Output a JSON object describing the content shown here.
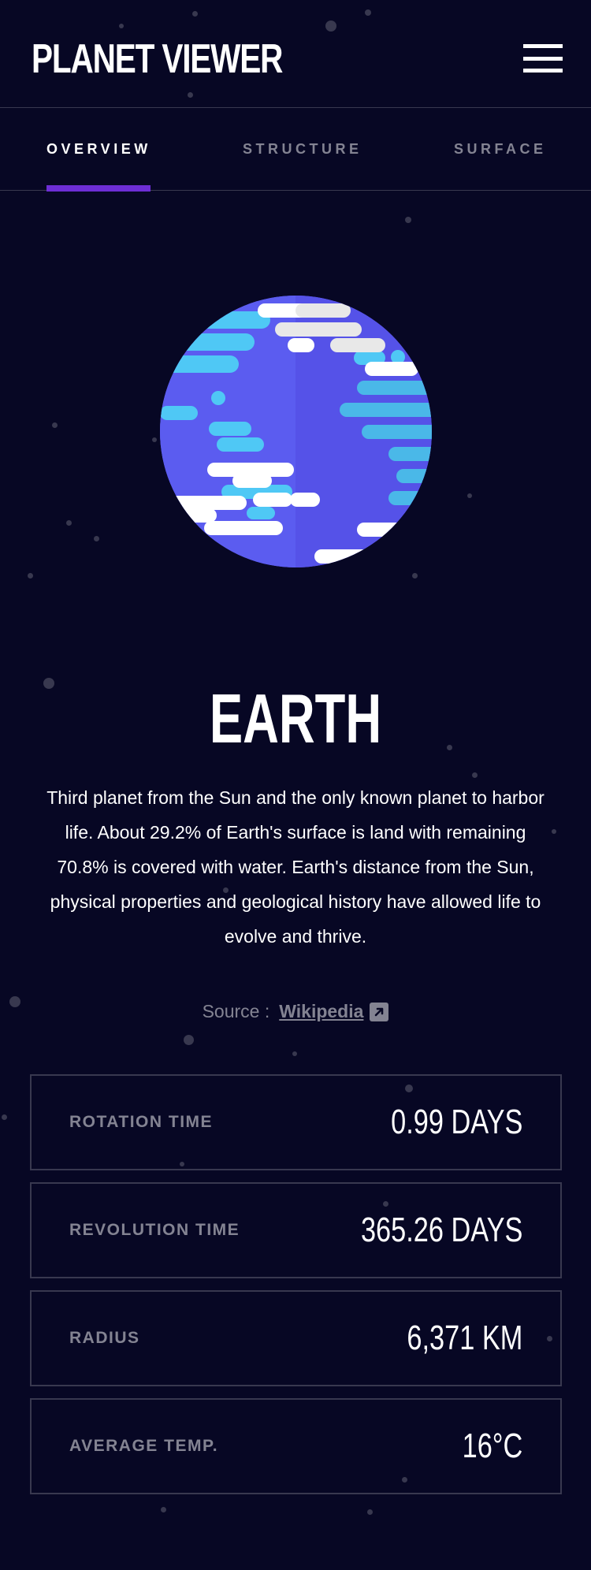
{
  "app": {
    "title": "PLANET VIEWER",
    "menu_icon": "hamburger-menu-icon"
  },
  "colors": {
    "background": "#070724",
    "accent": "#6D2ED5",
    "border": "#38384F"
  },
  "tabs": [
    {
      "label": "OVERVIEW",
      "active": true
    },
    {
      "label": "STRUCTURE",
      "active": false
    },
    {
      "label": "SURFACE",
      "active": false
    }
  ],
  "planet": {
    "name": "EARTH",
    "image_icon": "earth-planet-icon",
    "description": "Third planet from the Sun and the only known planet to harbor life. About 29.2% of Earth's surface is land with remaining 70.8% is covered with water. Earth's distance from the Sun, physical properties and geological history have allowed life to evolve and thrive.",
    "source_label": "Source :",
    "source_link": "Wikipedia",
    "source_icon": "external-link-icon"
  },
  "stats": [
    {
      "label": "ROTATION TIME",
      "value": "0.99 DAYS"
    },
    {
      "label": "REVOLUTION TIME",
      "value": "365.26 DAYS"
    },
    {
      "label": "RADIUS",
      "value": "6,371 KM"
    },
    {
      "label": "AVERAGE TEMP.",
      "value": "16°C"
    }
  ]
}
